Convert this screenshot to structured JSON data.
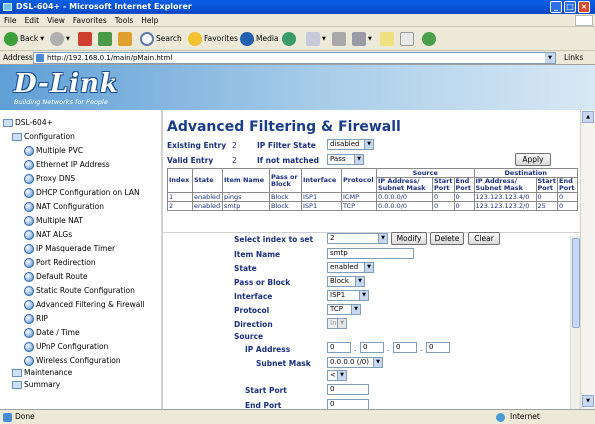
{
  "window": {
    "title": "DSL-604+ - Microsoft Internet Explorer"
  },
  "menu": [
    "File",
    "Edit",
    "View",
    "Favorites",
    "Tools",
    "Help"
  ],
  "toolbar": {
    "back": "Back",
    "search": "Search",
    "favorites": "Favorites",
    "media": "Media"
  },
  "address": {
    "label": "Address",
    "url": "http://192.168.0.1/main/pMain.html",
    "links": "Links"
  },
  "brand": {
    "logo": "D-Link",
    "tagline": "Building Networks for People"
  },
  "tree": {
    "root": "DSL-604+",
    "configuration": "Configuration",
    "children": [
      "Multiple PVC",
      "Ethernet IP Address",
      "Proxy DNS",
      "DHCP Configuration on LAN",
      "NAT Configuration",
      "Multiple NAT",
      "NAT ALGs",
      "IP Masquerade Timer",
      "Port Redirection",
      "Default Route",
      "Static Route Configuration",
      "Advanced Filtering & Firewall",
      "RIP",
      "Date / Time",
      "UPnP Configuration",
      "Wireless Configuration"
    ],
    "maintenance": "Maintenance",
    "summary": "Summary"
  },
  "page": {
    "title": "Advanced Filtering & Firewall",
    "existing_label": "Existing Entry",
    "existing_value": "2",
    "valid_label": "Valid Entry",
    "valid_value": "2",
    "filter_state_label": "IP Filter State",
    "filter_state_value": "disabled",
    "not_matched_label": "If not matched",
    "not_matched_value": "Pass",
    "apply": "Apply"
  },
  "table": {
    "group_source": "Source",
    "group_destination": "Destination",
    "headers": [
      "Index",
      "State",
      "Item Name",
      "Pass or Block",
      "Interface",
      "Protocol",
      "IP Address/ Subnet Mask",
      "Start Port",
      "End Port",
      "IP Address/ Subnet Mask",
      "Start Port",
      "End Port"
    ],
    "rows": [
      [
        "1",
        "enabled",
        "pings",
        "Block",
        "ISP1",
        "ICMP",
        "0.0.0.0/0",
        "0",
        "0",
        "123.123.123.4/0",
        "0",
        "0"
      ],
      [
        "2",
        "enabled",
        "smtp",
        "Block",
        "ISP1",
        "TCP",
        "0.0.0.0/0",
        "0",
        "0",
        "123.123.123.2/0",
        "25",
        "0"
      ]
    ]
  },
  "form": {
    "select_index_label": "Select index to set",
    "select_index_value": "2",
    "modify": "Modify",
    "delete": "Delete",
    "clear": "Clear",
    "item_name_label": "Item Name",
    "item_name_value": "smtp",
    "state_label": "State",
    "state_value": "enabled",
    "pass_block_label": "Pass or Block",
    "pass_block_value": "Block",
    "interface_label": "Interface",
    "interface_value": "ISP1",
    "protocol_label": "Protocol",
    "protocol_value": "TCP",
    "direction_label": "Direction",
    "direction_value": "In",
    "source_label": "Source",
    "ip_label": "IP Address",
    "ip_octets": [
      "0",
      "0",
      "0",
      "0"
    ],
    "subnet_label": "Subnet Mask",
    "subnet_value": "0.0.0.0 (/0)",
    "start_port_label": "Start Port",
    "start_port_value": "0",
    "end_port_label": "End Port",
    "end_port_value": "0"
  },
  "status": {
    "left": "Done",
    "zone": "Internet"
  }
}
